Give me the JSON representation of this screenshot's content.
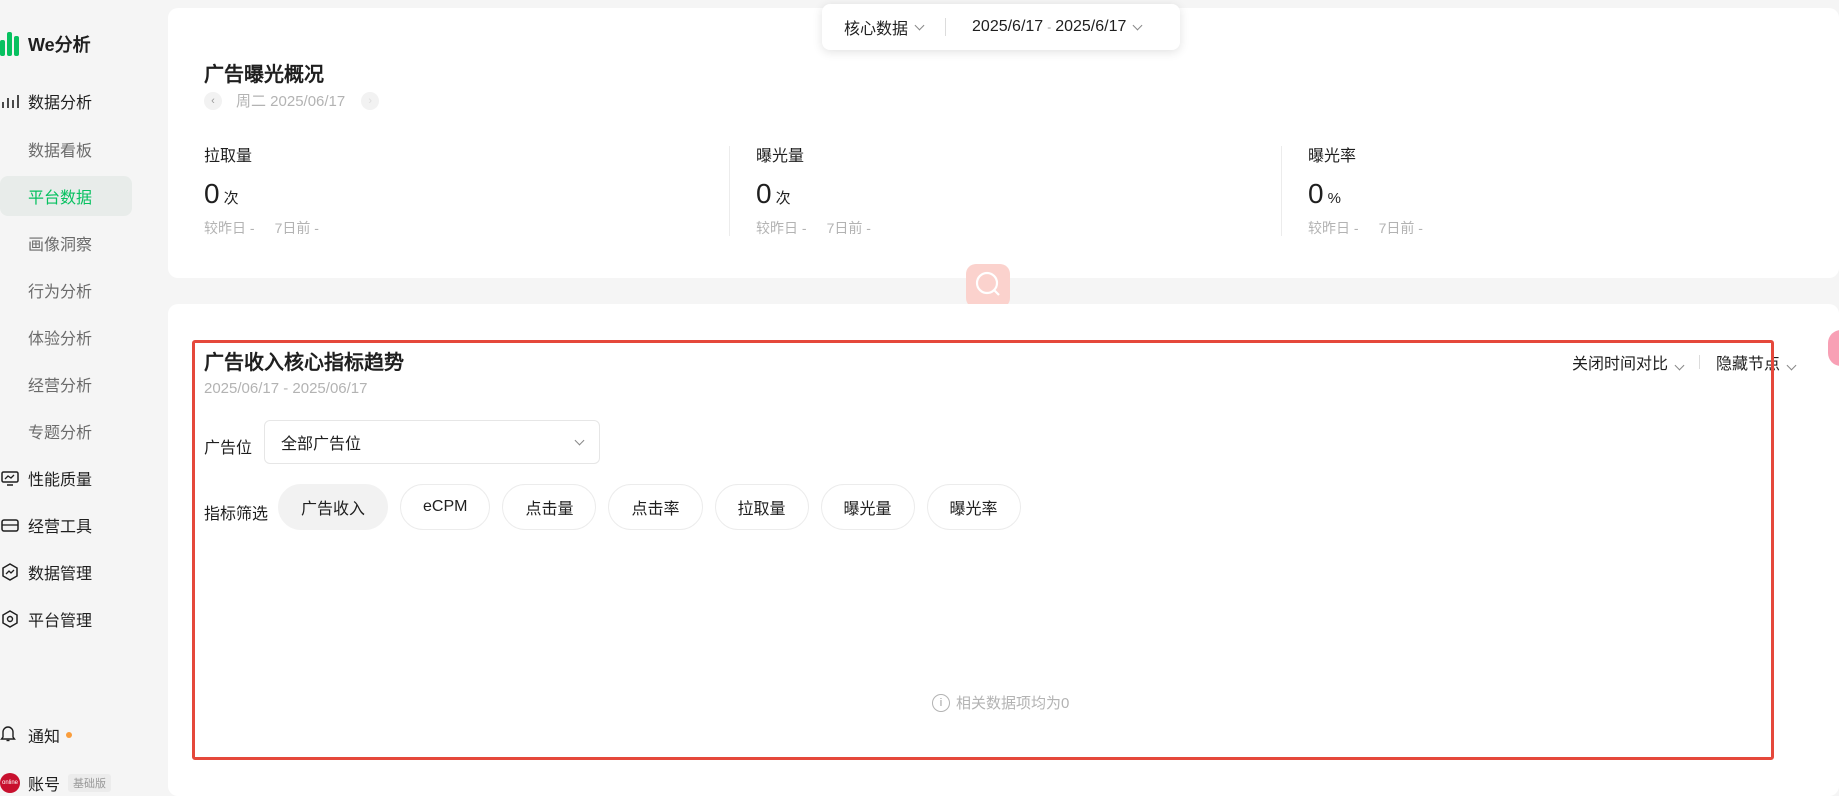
{
  "app": {
    "name": "We分析"
  },
  "sidebar": {
    "groups": [
      {
        "label": "数据分析",
        "icon": "bar-chart-icon"
      },
      {
        "label": "性能质量",
        "icon": "monitor-icon"
      },
      {
        "label": "经营工具",
        "icon": "toolbox-icon"
      },
      {
        "label": "数据管理",
        "icon": "trend-icon"
      },
      {
        "label": "平台管理",
        "icon": "hexagon-gear-icon"
      }
    ],
    "items": [
      {
        "label": "数据看板"
      },
      {
        "label": "平台数据",
        "active": true
      },
      {
        "label": "画像洞察"
      },
      {
        "label": "行为分析"
      },
      {
        "label": "体验分析"
      },
      {
        "label": "经营分析"
      },
      {
        "label": "专题分析"
      }
    ],
    "notification": {
      "label": "通知"
    },
    "account": {
      "label": "账号",
      "badge": "基础版",
      "avatar_text": "online"
    }
  },
  "top_selector": {
    "category": "核心数据",
    "date_start": "2025/6/17",
    "date_sep": "-",
    "date_end": "2025/6/17"
  },
  "overview": {
    "title": "广告曝光概况",
    "date_label": "周二 2025/06/17",
    "metrics": [
      {
        "label": "拉取量",
        "value": "0",
        "unit": "次",
        "vs_yesterday": "较昨日 -",
        "vs_week": "7日前 -"
      },
      {
        "label": "曝光量",
        "value": "0",
        "unit": "次",
        "vs_yesterday": "较昨日 -",
        "vs_week": "7日前 -"
      },
      {
        "label": "曝光率",
        "value": "0",
        "unit": "%",
        "vs_yesterday": "较昨日 -",
        "vs_week": "7日前 -"
      }
    ]
  },
  "trend": {
    "title": "广告收入核心指标趋势",
    "range": "2025/06/17 - 2025/06/17",
    "compare_toggle": "关闭时间对比",
    "node_toggle": "隐藏节点",
    "ad_position_label": "广告位",
    "ad_position_value": "全部广告位",
    "filter_label": "指标筛选",
    "chips": [
      "广告收入",
      "eCPM",
      "点击量",
      "点击率",
      "拉取量",
      "曝光量",
      "曝光率"
    ],
    "active_chip": "广告收入",
    "empty_text": "相关数据项均为0"
  },
  "colors": {
    "accent": "#07c160",
    "highlight": "#e5483b",
    "notif_dot": "#fa9d3b"
  }
}
